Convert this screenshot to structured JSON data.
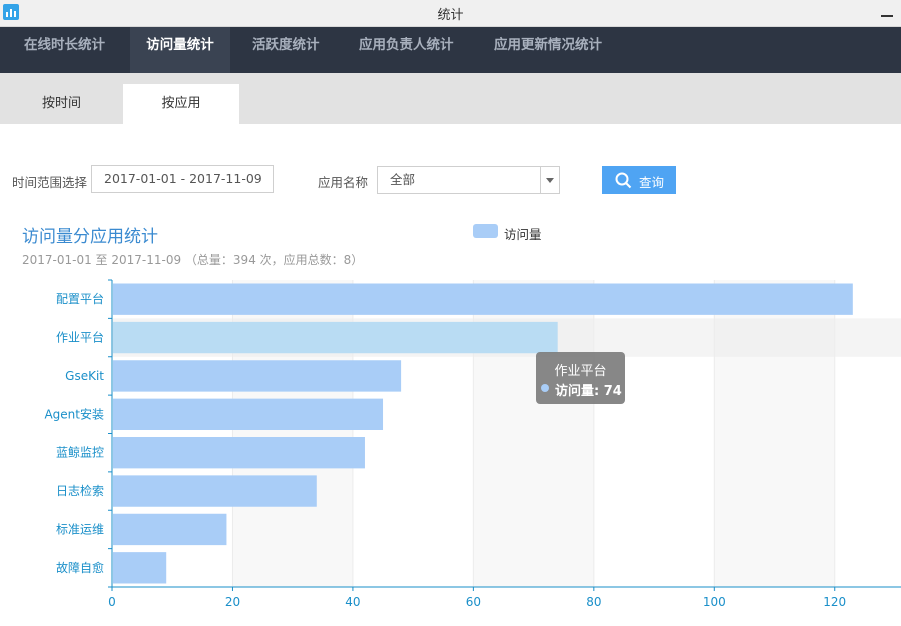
{
  "window": {
    "title": "统计"
  },
  "topnav": [
    {
      "label": "在线时长统计"
    },
    {
      "label": "访问量统计"
    },
    {
      "label": "活跃度统计"
    },
    {
      "label": "应用负责人统计"
    },
    {
      "label": "应用更新情况统计"
    }
  ],
  "subnav": [
    {
      "label": "按时间"
    },
    {
      "label": "按应用"
    }
  ],
  "filters": {
    "time_label": "时间范围选择",
    "time_value": "2017-01-01 - 2017-11-09",
    "app_label": "应用名称",
    "app_value": "全部",
    "query_label": "查询"
  },
  "chart_title": "访问量分应用统计",
  "chart_subtitle": "2017-01-01 至 2017-11-09 （总量：394 次，应用总数：8）",
  "tooltip": {
    "title": "作业平台",
    "value": "访问量: 74"
  },
  "colors": {
    "bar": "#a9cdf7",
    "bar_highlight": "#b9dcf3",
    "axis": "#1a8fc9",
    "nav_bg": "#2d3543",
    "button": "#4fa4f3"
  },
  "chart_data": {
    "type": "bar",
    "orientation": "horizontal",
    "categories": [
      "配置平台",
      "作业平台",
      "GseKit",
      "Agent安装",
      "蓝鲸监控",
      "日志检索",
      "标准运维",
      "故障自愈"
    ],
    "series": [
      {
        "name": "访问量",
        "values": [
          123,
          74,
          48,
          45,
          42,
          34,
          19,
          9
        ]
      }
    ],
    "xticks": [
      0,
      20,
      40,
      60,
      80,
      100,
      120
    ],
    "xlim": [
      0,
      131
    ],
    "legend": "top-center",
    "highlighted": "作业平台",
    "grid": true
  }
}
